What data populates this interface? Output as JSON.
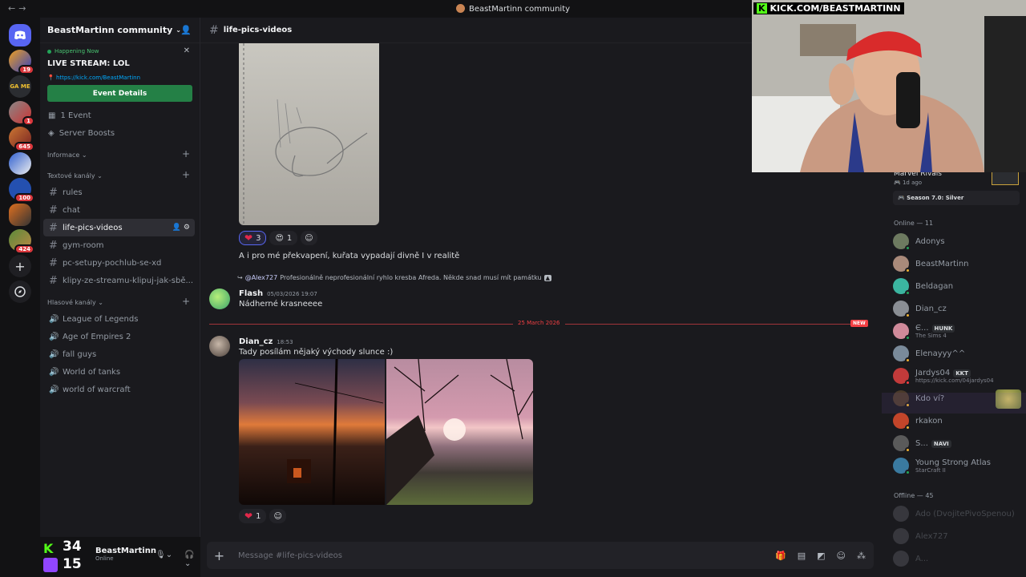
{
  "window": {
    "title": "BeastMartinn community"
  },
  "rail": {
    "badges": [
      "19",
      "1",
      "645",
      "100",
      "424"
    ],
    "game_label": "GA ME"
  },
  "sidebar": {
    "server_name": "BeastMartinn community",
    "event": {
      "status": "Happening Now",
      "title": "LIVE STREAM: LOL",
      "url": "https://kick.com/BeastMartinn",
      "button": "Event Details"
    },
    "items": [
      {
        "label": "1 Event"
      },
      {
        "label": "Server Boosts"
      }
    ],
    "categories": {
      "info": "Informace",
      "text": "Textové kanály",
      "voice": "Hlasové kanály"
    },
    "text_channels": [
      "rules",
      "chat",
      "life-pics-videos",
      "gym-room",
      "pc-setupy-pochlub-se-xd",
      "klipy-ze-streamu-klipuj-jak-sbě..."
    ],
    "voice_channels": [
      "League of Legends",
      "Age of Empires 2",
      "fall guys",
      "World of tanks",
      "world of warcraft"
    ],
    "user": {
      "name": "BeastMartinn",
      "status": "Online",
      "kick_count": "34",
      "twitch_count": "15"
    }
  },
  "channel": {
    "name": "life-pics-videos",
    "placeholder": "Message #life-pics-videos"
  },
  "messages": {
    "first_reactions": [
      {
        "emoji": "❤",
        "count": "3"
      },
      {
        "emoji": "😍",
        "count": "1"
      }
    ],
    "first_text": "A i pro mé překvapení, kuřata vypadají divně I v realitě",
    "reply": {
      "ref": "@Alex727",
      "ref_text": "Profesionálně neprofesionální ryhlo kresba Afreda. Někde snad musí mít památku",
      "author": "Flash",
      "time": "05/03/2026 19:07",
      "text": "Nádherné krasneeee"
    },
    "divider": {
      "date": "25 March 2026",
      "badge": "NEW"
    },
    "post": {
      "author": "Dian_cz",
      "time": "18:53",
      "text": "Tady posílám nějaký východy slunce :)",
      "reaction_count": "1"
    }
  },
  "members": {
    "activity": {
      "game": "Marvel Rivals",
      "time": "1d ago",
      "detail": "Season 7.0: Silver"
    },
    "online_header": "Online — 11",
    "online": [
      {
        "name": "Adonys",
        "sub": ""
      },
      {
        "name": "BeastMartinn",
        "sub": ""
      },
      {
        "name": "Beldagan",
        "sub": ""
      },
      {
        "name": "Dian_cz",
        "sub": ""
      },
      {
        "name": "Є...",
        "sub": "The Sims 4",
        "tag": "HUNK"
      },
      {
        "name": "Elenayyy^^",
        "sub": ""
      },
      {
        "name": "Jardys04",
        "sub": "https://kick.com/04jardys04",
        "tag": "KKT"
      },
      {
        "name": "Kdo ví?",
        "sub": ""
      },
      {
        "name": "rkakon",
        "sub": ""
      },
      {
        "name": "S...",
        "sub": "",
        "tag": "NAVI"
      },
      {
        "name": "Young Strong Atlas",
        "sub": "StarCraft II"
      }
    ],
    "offline_header": "Offline — 45",
    "offline": [
      {
        "name": "Ado (DvojitePivoSpenou)"
      },
      {
        "name": "Alex727"
      },
      {
        "name": "A..."
      }
    ]
  },
  "overlay": {
    "kick_banner": "KICK.COM/BEASTMARTINN"
  },
  "colors": {
    "accent": "#5865f2",
    "green": "#248046",
    "danger": "#f23f43",
    "bg": "#1a1a1e"
  }
}
